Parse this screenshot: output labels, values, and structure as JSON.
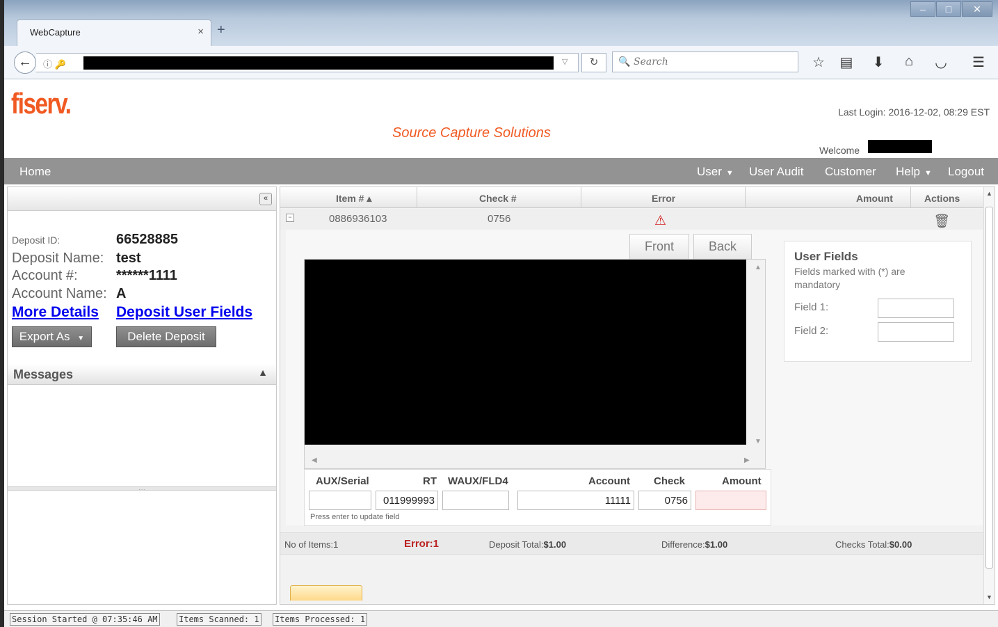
{
  "browser": {
    "tab_title": "WebCapture",
    "tab_close": "×",
    "new_tab": "+",
    "search_placeholder": "Search"
  },
  "header": {
    "logo": "fiserv.",
    "app_title": "Source Capture Solutions",
    "last_login": "Last Login: 2016-12-02, 08:29 EST",
    "welcome": "Welcome"
  },
  "menu": {
    "home": "Home",
    "user": "User",
    "user_audit": "User Audit",
    "customer": "Customer",
    "help": "Help",
    "logout": "Logout"
  },
  "deposit": {
    "id_label": "Deposit ID:",
    "id_value": "66528885",
    "name_label": "Deposit Name:",
    "name_value": "test",
    "account_label": "Account #:",
    "account_value": "******1111",
    "account_name_label": "Account Name:",
    "account_name_value": "A",
    "more_details": "More Details",
    "deposit_user_fields": "Deposit User Fields",
    "export_as": "Export As",
    "delete_deposit": "Delete Deposit",
    "messages_title": "Messages"
  },
  "grid": {
    "columns": [
      "Item # ▴",
      "Check #",
      "Error",
      "Amount",
      "Actions"
    ],
    "row": {
      "item": "0886936103",
      "check": "0756"
    }
  },
  "detail": {
    "front_tab": "Front",
    "back_tab": "Back",
    "field_headers": {
      "aux_serial": "AUX/Serial",
      "rt": "RT",
      "waux": "WAUX/FLD4",
      "account": "Account",
      "check": "Check",
      "amount": "Amount"
    },
    "values": {
      "aux_serial": "",
      "rt": "011999993",
      "waux": "",
      "account": "11111",
      "check": "0756",
      "amount": ""
    },
    "note": "Press enter to update field"
  },
  "user_fields": {
    "title": "User Fields",
    "note": "Fields marked with (*) are mandatory",
    "field1_label": "Field 1:",
    "field2_label": "Field 2:"
  },
  "summary": {
    "items": "No of Items:1",
    "error": "Error:1",
    "deposit_total_label": "Deposit Total:",
    "deposit_total": "$1.00",
    "difference_label": "Difference:",
    "difference": "$1.00",
    "checks_total_label": "Checks Total:",
    "checks_total": "$0.00"
  },
  "status": {
    "session": "Session Started @ 07:35:46 AM",
    "scanned": "Items Scanned: 1",
    "processed": "Items Processed: 1"
  },
  "colors": {
    "brand": "#f05a22",
    "menu_bg": "#939393",
    "link": "#0000ee",
    "error": "#d42020"
  }
}
